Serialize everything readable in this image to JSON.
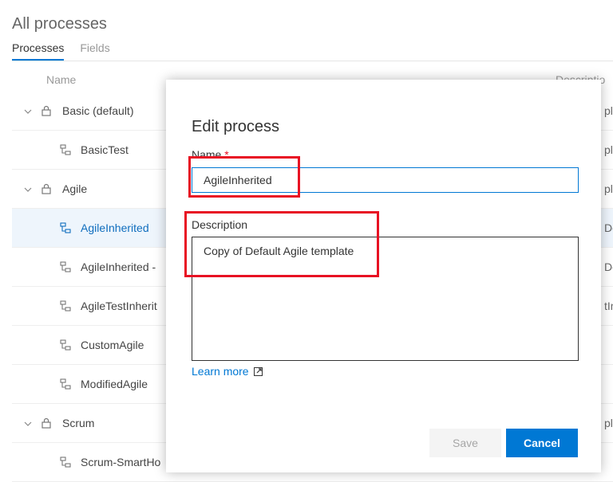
{
  "page": {
    "title": "All processes",
    "tabs": [
      {
        "label": "Processes",
        "active": true
      },
      {
        "label": "Fields",
        "active": false
      }
    ],
    "columns": {
      "name": "Name",
      "description": "Descriptio"
    }
  },
  "processes": [
    {
      "label": "Basic (default)",
      "type": "system",
      "expanded": true,
      "desc_fragment": "pl"
    },
    {
      "label": "BasicTest",
      "type": "inherited",
      "desc_fragment": "pl"
    },
    {
      "label": "Agile",
      "type": "system",
      "expanded": true,
      "desc_fragment": "pl"
    },
    {
      "label": "AgileInherited",
      "type": "inherited",
      "selected": true,
      "desc_fragment": "De"
    },
    {
      "label": "AgileInherited -",
      "type": "inherited",
      "desc_fragment": "De"
    },
    {
      "label": "AgileTestInherit",
      "type": "inherited",
      "desc_fragment": "tIn"
    },
    {
      "label": "CustomAgile",
      "type": "inherited",
      "desc_fragment": ""
    },
    {
      "label": "ModifiedAgile",
      "type": "inherited",
      "desc_fragment": ""
    },
    {
      "label": "Scrum",
      "type": "system",
      "expanded": true,
      "desc_fragment": "pl"
    },
    {
      "label": "Scrum-SmartHo",
      "type": "inherited",
      "desc_fragment": ""
    }
  ],
  "dialog": {
    "title": "Edit process",
    "name_label": "Name",
    "required_marker": "*",
    "name_value": "AgileInherited",
    "description_label": "Description",
    "description_value": "Copy of Default Agile template",
    "learn_more": "Learn more",
    "save_label": "Save",
    "cancel_label": "Cancel"
  },
  "icons": {
    "expander": "chevron-down-icon",
    "system_process": "lock-icon",
    "inherited_process": "inherit-icon",
    "external_link": "external-link-icon"
  },
  "colors": {
    "accent": "#0078d4",
    "selected_row_bg": "#eef5fc",
    "highlight": "#e81123",
    "disabled_button_bg": "#f4f4f4"
  }
}
